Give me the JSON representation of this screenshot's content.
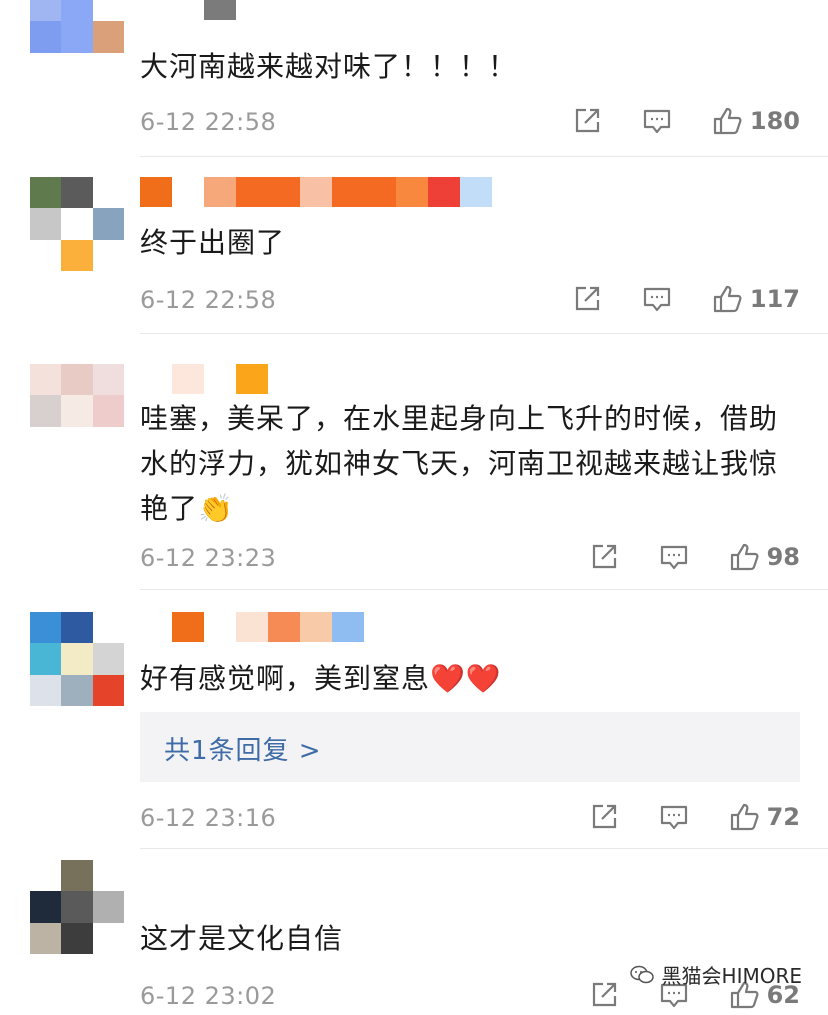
{
  "comments": [
    {
      "text": "大河南越来越对味了！！！！",
      "time": "6-12 22:58",
      "likes": "180",
      "avatar_colors": [
        "#9fb6f2",
        "#8aa8f5",
        "#ffffff",
        "#7e9df0",
        "#8aa8f5",
        "#d9a07a",
        "#ffffff",
        "#ffffff",
        "#ffffff"
      ],
      "name_colors": [
        "#ffffff",
        "#ffffff",
        "#7b7b7b"
      ]
    },
    {
      "text": "终于出圈了",
      "time": "6-12 22:58",
      "likes": "117",
      "avatar_colors": [
        "#5f7a4c",
        "#5b5b5b",
        "#ffffff",
        "#c7c7c7",
        "#ffffff",
        "#88a3bd",
        "#ffffff",
        "#fbb03b",
        "#ffffff"
      ],
      "name_colors": [
        "#f06d1a",
        "#ffffff",
        "#f7a87a",
        "#f46a22",
        "#f46a22",
        "#f8c0a4",
        "#f46a22",
        "#f46a22",
        "#f8883e",
        "#ee4036",
        "#c2ddf8"
      ]
    },
    {
      "text": "哇塞，美呆了，在水里起身向上飞升的时候，借助水的浮力，犹如神女飞天，河南卫视越来越让我惊艳了",
      "emoji": "👏",
      "time": "6-12 23:23",
      "likes": "98",
      "avatar_colors": [
        "#f4e1dc",
        "#e9cbc6",
        "#f0dede",
        "#d8cfcf",
        "#f6eae4",
        "#eecccc",
        "#ffffff",
        "#ffffff",
        "#ffffff"
      ],
      "name_colors": [
        "#ffffff",
        "#fde6dc",
        "#ffffff",
        "#fba51a"
      ]
    },
    {
      "text": "好有感觉啊，美到窒息",
      "emoji": "❤️❤️",
      "reply": "共1条回复 >",
      "time": "6-12 23:16",
      "likes": "72",
      "avatar_colors": [
        "#3a8fd6",
        "#2e5aa1",
        "#ffffff",
        "#48b6d4",
        "#f3ebc6",
        "#d4d4d4",
        "#dde2ea",
        "#9eb0bd",
        "#e6432b"
      ],
      "name_colors": [
        "#ffffff",
        "#f06d1a",
        "#ffffff",
        "#fbe3d4",
        "#f68b55",
        "#f8caa8",
        "#8fbdf2"
      ]
    },
    {
      "text": "这才是文化自信",
      "time": "6-12 23:02",
      "likes": "62",
      "avatar_colors": [
        "#ffffff",
        "#77705a",
        "#ffffff",
        "#1f2a3a",
        "#5a5a5a",
        "#b0b0b0",
        "#bcb3a4",
        "#3d3d3d",
        "#ffffff"
      ],
      "name_colors": []
    }
  ],
  "watermark": "黑猫会HIMORE",
  "colors": {
    "text": "#1a1a1a",
    "time": "#9a9a9a",
    "reply_link": "#3f6ba6",
    "icon": "#7a7a7a"
  },
  "icons": {
    "share": "share-icon",
    "comment": "comment-icon",
    "like": "thumbs-up-icon",
    "watermark": "wechat-icon"
  }
}
